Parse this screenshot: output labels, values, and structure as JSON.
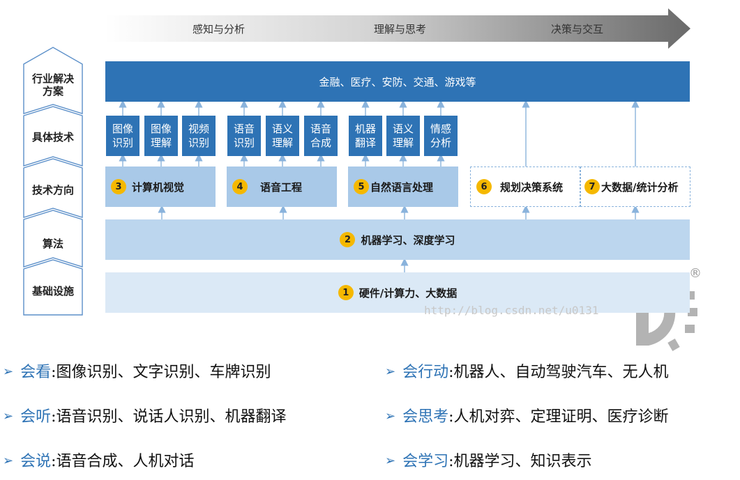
{
  "progress_arrow": {
    "stages": [
      "感知与分析",
      "理解与思考",
      "决策与交互"
    ]
  },
  "layers": [
    "行业解决方案",
    "具体技术",
    "技术方向",
    "算法",
    "基础设施"
  ],
  "industry": "金融、医疗、安防、交通、游戏等",
  "tech_groups": [
    {
      "tiles": [
        [
          "图像",
          "识别"
        ],
        [
          "图像",
          "理解"
        ],
        [
          "视频",
          "识别"
        ]
      ]
    },
    {
      "tiles": [
        [
          "语音",
          "识别"
        ],
        [
          "语义",
          "理解"
        ],
        [
          "语音",
          "合成"
        ]
      ]
    },
    {
      "tiles": [
        [
          "机器",
          "翻译"
        ],
        [
          "语义",
          "理解"
        ],
        [
          "情感",
          "分析"
        ]
      ]
    }
  ],
  "directions": [
    {
      "num": "3",
      "label": "计算机视觉"
    },
    {
      "num": "4",
      "label": "语音工程"
    },
    {
      "num": "5",
      "label": "自然语言处理"
    },
    {
      "num": "6",
      "label": "规划决策系统"
    },
    {
      "num": "7",
      "label": "大数据/统计分析"
    }
  ],
  "algorithm": {
    "num": "2",
    "label": "机器学习、深度学习"
  },
  "infrastructure": {
    "num": "1",
    "label": "硬件/计算力、大数据"
  },
  "watermark": "http://blog.csdn.net/u0131",
  "logo": {
    "registered": "®"
  },
  "bullets": [
    {
      "marker": "➢",
      "category": "会看",
      "items": ":图像识别、文字识别、车牌识别"
    },
    {
      "marker": "➢",
      "category": "会行动",
      "items": ":机器人、自动驾驶汽车、无人机"
    },
    {
      "marker": "➢",
      "category": "会听",
      "items": ":语音识别、说话人识别、机器翻译"
    },
    {
      "marker": "➢",
      "category": "会思考",
      "items": ":人机对弈、定理证明、医疗诊断"
    },
    {
      "marker": "➢",
      "category": "会说",
      "items": ":语音合成、人机对话"
    },
    {
      "marker": "➢",
      "category": "会学习",
      "items": ":机器学习、知识表示"
    }
  ],
  "colors": {
    "primary": "#2e73b5",
    "direction": "#a9c9e8",
    "algorithm": "#bcd6ee",
    "infrastructure": "#dbe9f6",
    "badge": "#f5b800"
  }
}
